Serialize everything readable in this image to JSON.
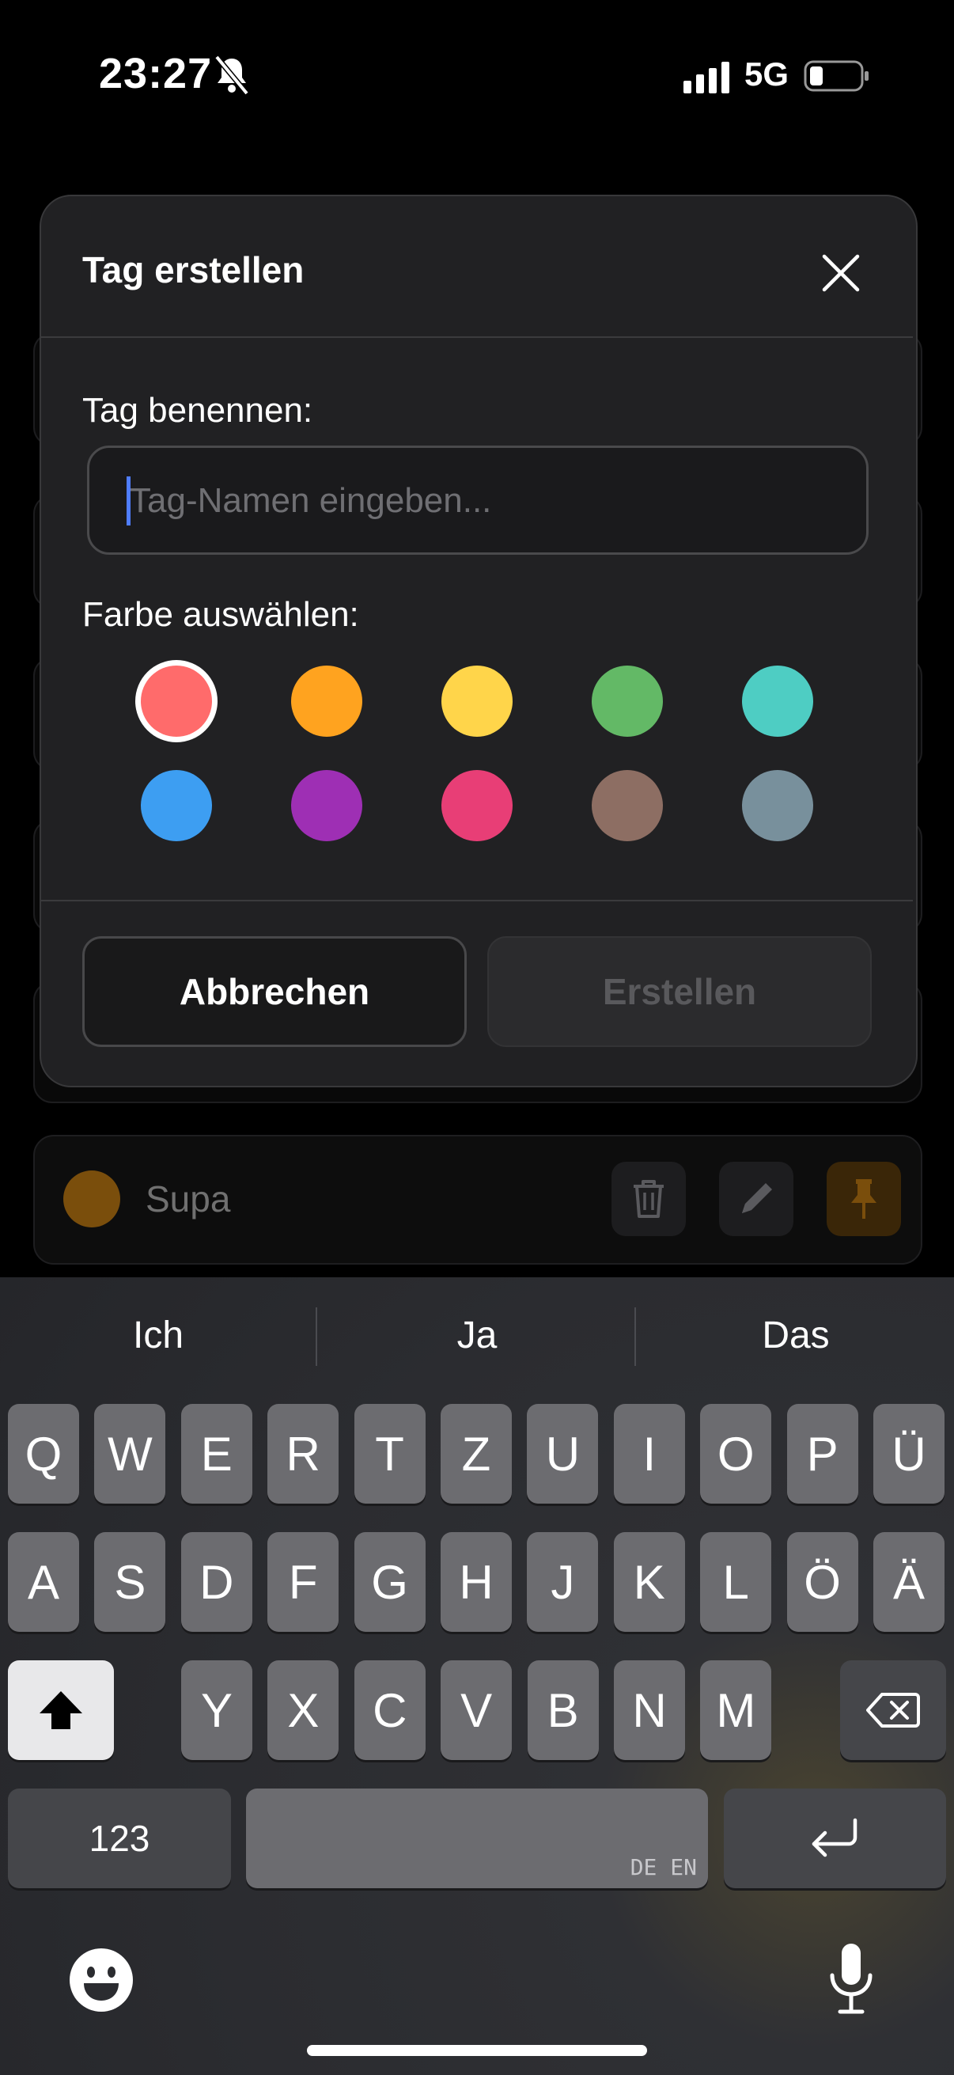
{
  "status": {
    "time": "23:27",
    "network": "5G"
  },
  "background": {
    "item_label": "Supa",
    "item_color": "#7a4e0c"
  },
  "dialog": {
    "title": "Tag erstellen",
    "name_label": "Tag benennen:",
    "name_placeholder": "Tag-Namen eingeben...",
    "name_value": "",
    "color_label": "Farbe auswählen:",
    "colors": [
      "#ff6b6b",
      "#ffa31f",
      "#ffd54a",
      "#63b966",
      "#4ecdc3",
      "#3d9ef2",
      "#9e2fb4",
      "#e83e76",
      "#8d6e63",
      "#78909c"
    ],
    "selected_color": "#ff6b6b",
    "cancel_label": "Abbrechen",
    "create_label": "Erstellen"
  },
  "keyboard": {
    "suggestions": [
      "Ich",
      "Ja",
      "Das"
    ],
    "row1": [
      "Q",
      "W",
      "E",
      "R",
      "T",
      "Z",
      "U",
      "I",
      "O",
      "P",
      "Ü"
    ],
    "row2": [
      "A",
      "S",
      "D",
      "F",
      "G",
      "H",
      "J",
      "K",
      "L",
      "Ö",
      "Ä"
    ],
    "row3": [
      "Y",
      "X",
      "C",
      "V",
      "B",
      "N",
      "M"
    ],
    "numbers_label": "123",
    "space_languages": "DE EN"
  }
}
